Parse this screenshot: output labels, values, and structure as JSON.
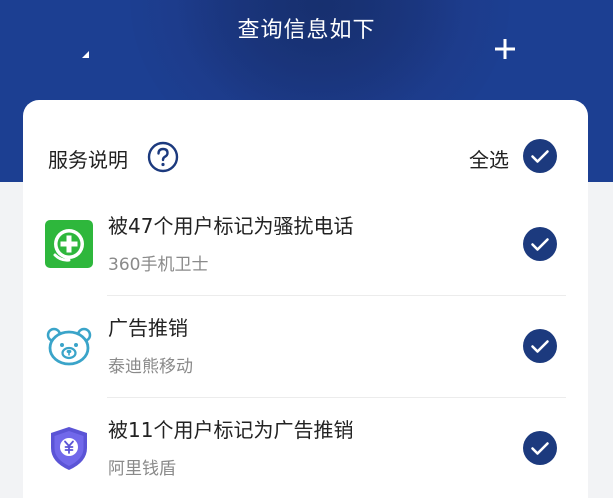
{
  "header": {
    "title": "查询信息如下",
    "bg_color": "#1c3f92"
  },
  "service": {
    "label": "服务说明",
    "help_icon": "question-circle-icon",
    "select_all_label": "全选",
    "select_all_checked": true
  },
  "items": [
    {
      "title": "被47个用户标记为骚扰电话",
      "source": "360手机卫士",
      "logo_icon": "360-security-logo-icon",
      "checked": true
    },
    {
      "title": "广告推销",
      "source": "泰迪熊移动",
      "logo_icon": "teddy-bear-logo-icon",
      "checked": true
    },
    {
      "title": "被11个用户标记为广告推销",
      "source": "阿里钱盾",
      "logo_icon": "ali-shield-logo-icon",
      "checked": true
    }
  ],
  "colors": {
    "accent": "#1c3f92",
    "check": "#1c3a7e"
  }
}
